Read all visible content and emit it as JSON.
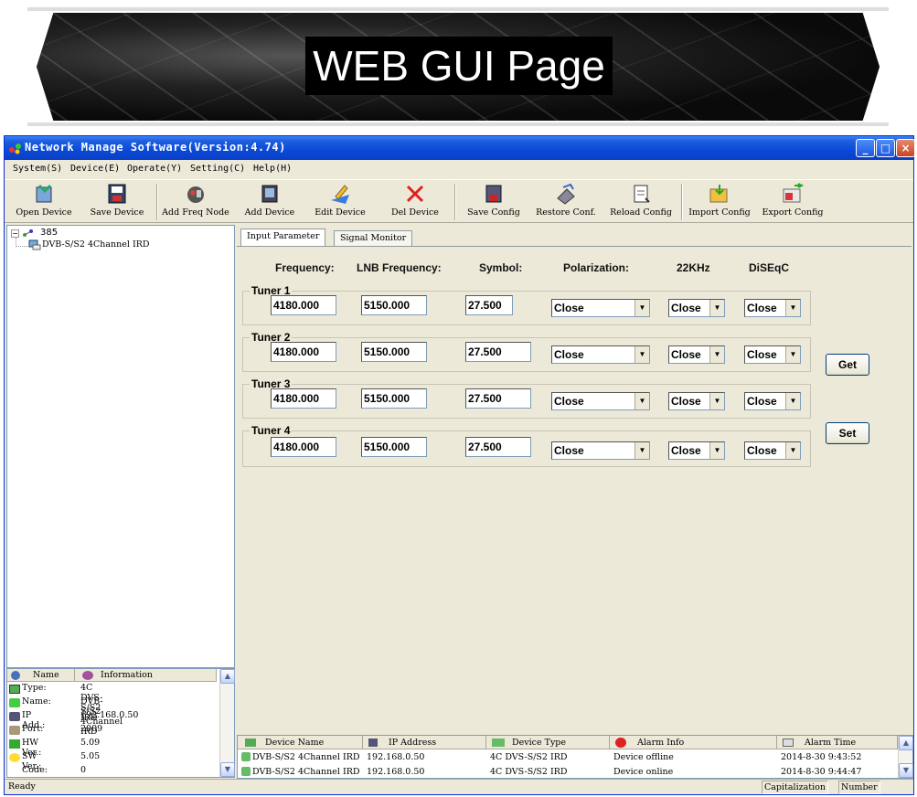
{
  "banner": {
    "title": "WEB GUI Page"
  },
  "window": {
    "title": "Network Manage Software(Version:4.74)",
    "controls": {
      "minimize": "_",
      "maximize": "□",
      "close": "×"
    }
  },
  "menu": [
    "System(S)",
    "Device(E)",
    "Operate(Y)",
    "Setting(C)",
    "Help(H)"
  ],
  "toolbar": [
    {
      "label": "Open Device",
      "icon": "open-device-icon"
    },
    {
      "label": "Save Device",
      "icon": "save-device-icon"
    },
    {
      "label": "Add Freq Node",
      "icon": "add-freq-node-icon"
    },
    {
      "label": "Add Device",
      "icon": "add-device-icon"
    },
    {
      "label": "Edit Device",
      "icon": "edit-device-icon"
    },
    {
      "label": "Del Device",
      "icon": "delete-icon"
    },
    {
      "label": "Save Config",
      "icon": "save-config-icon"
    },
    {
      "label": "Restore Conf.",
      "icon": "restore-config-icon"
    },
    {
      "label": "Reload Config",
      "icon": "reload-config-icon"
    },
    {
      "label": "Import Config",
      "icon": "import-config-icon"
    },
    {
      "label": "Export Config",
      "icon": "export-config-icon"
    }
  ],
  "tree": {
    "root": "385",
    "child": "DVB-S/S2 4Channel IRD"
  },
  "info": {
    "headers": [
      "Name",
      "Information"
    ],
    "rows": [
      {
        "k": "Type:",
        "v": "4C DVS-S/S2 IRD"
      },
      {
        "k": "Name:",
        "v": "DVB-S/S2 4Channel IRD"
      },
      {
        "k": "IP Add.:",
        "v": "192.168.0.50"
      },
      {
        "k": "Port:",
        "v": "2009"
      },
      {
        "k": "HW Ver.:",
        "v": "5.09"
      },
      {
        "k": "SW Ver.:",
        "v": "5.05"
      },
      {
        "k": "Code:",
        "v": "0"
      }
    ]
  },
  "tabs": [
    "Input Parameter",
    "Signal Monitor"
  ],
  "columns": [
    "Frequency:",
    "LNB Frequency:",
    "Symbol:",
    "Polarization:",
    "22KHz",
    "DiSEqC"
  ],
  "tuners": [
    {
      "label": "Tuner 1",
      "frequency": "4180.000",
      "lnb": "5150.000",
      "symbol": "27.500",
      "polarization": "Close",
      "k22": "Close",
      "diseqc": "Close"
    },
    {
      "label": "Tuner 2",
      "frequency": "4180.000",
      "lnb": "5150.000",
      "symbol": "27.500",
      "polarization": "Close",
      "k22": "Close",
      "diseqc": "Close"
    },
    {
      "label": "Tuner 3",
      "frequency": "4180.000",
      "lnb": "5150.000",
      "symbol": "27.500",
      "polarization": "Close",
      "k22": "Close",
      "diseqc": "Close"
    },
    {
      "label": "Tuner 4",
      "frequency": "4180.000",
      "lnb": "5150.000",
      "symbol": "27.500",
      "polarization": "Close",
      "k22": "Close",
      "diseqc": "Close"
    }
  ],
  "buttons": {
    "get": "Get",
    "set": "Set"
  },
  "alarm": {
    "headers": [
      "Device Name",
      "IP Address",
      "Device Type",
      "Alarm Info",
      "Alarm Time"
    ],
    "rows": [
      {
        "name": "DVB-S/S2 4Channel IRD",
        "ip": "192.168.0.50",
        "type": "4C DVS-S/S2 IRD",
        "info": "Device offline",
        "time": "2014-8-30 9:43:52"
      },
      {
        "name": "DVB-S/S2 4Channel IRD",
        "ip": "192.168.0.50",
        "type": "4C DVS-S/S2 IRD",
        "info": "Device online",
        "time": "2014-8-30 9:44:47"
      }
    ]
  },
  "status": {
    "text": "Ready",
    "caps": "Capitalization",
    "num": "Number"
  }
}
